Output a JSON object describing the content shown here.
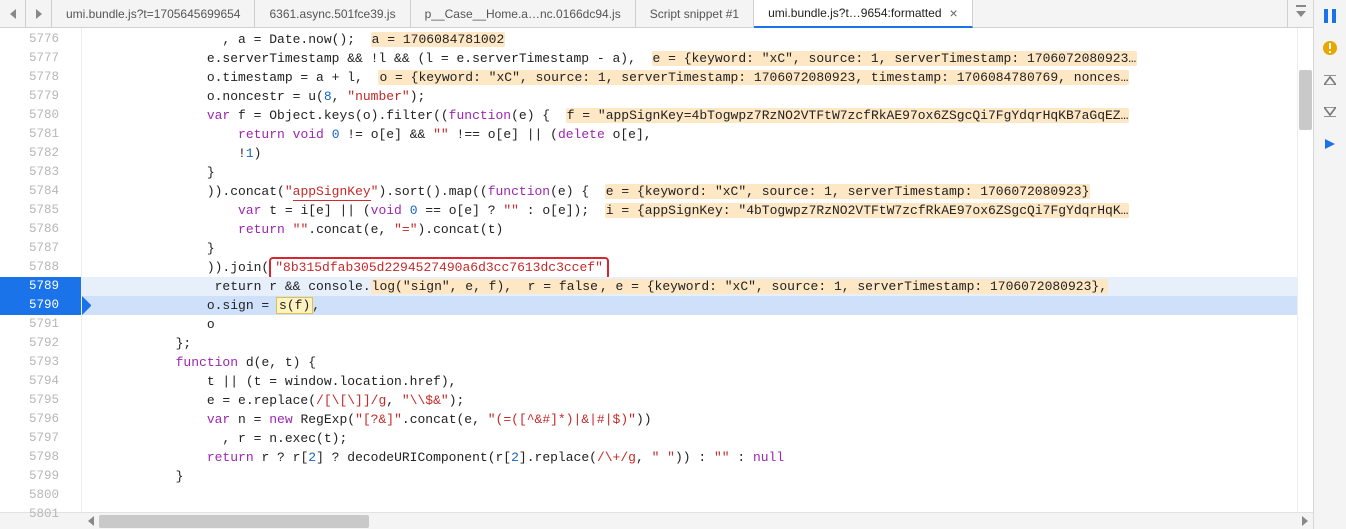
{
  "tabs": [
    {
      "label": "umi.bundle.js?t=1705645699654"
    },
    {
      "label": "6361.async.501fce39.js"
    },
    {
      "label": "p__Case__Home.a…nc.0166dc94.js"
    },
    {
      "label": "Script snippet #1"
    },
    {
      "label": "umi.bundle.js?t…9654:formatted",
      "active": true,
      "closable": true
    }
  ],
  "gutter": {
    "start": 5776,
    "end": 5801,
    "breakpoints": [
      5789,
      5790
    ],
    "paused": 5790
  },
  "side_rail": {
    "pause_color": "#1a73e8",
    "warn_color": "#e7a600"
  },
  "code": {
    "l5776": {
      "pre": "                  , a = Date.now();  ",
      "hl": "a = 1706084781002"
    },
    "l5777": {
      "pre": "                e.serverTimestamp && !l && (l = e.serverTimestamp - a),  ",
      "hl": "e = {keyword: \"xC\", source: 1, serverTimestamp: 1706072080923…"
    },
    "l5778": {
      "pre": "                o.timestamp = a + l,  ",
      "hl": "o = {keyword: \"xC\", source: 1, serverTimestamp: 1706072080923, timestamp: 1706084780769, nonces…"
    },
    "l5779": "                o.noncestr = u(8, \"number\");",
    "l5780": {
      "pre": "                var f = Object.keys(o).filter((function(e) {  ",
      "hl": "f = \"appSignKey=4bTogwpz7RzNO2VTFtW7zcfRkAE97ox6ZSgcQi7FgYdqrHqKB7aGqEZ…"
    },
    "l5781": "                    return void 0 != o[e] && \"\" !== o[e] || (delete o[e],",
    "l5782": "                    !1)",
    "l5783": "                }",
    "l5784": {
      "pre": "                )).concat(\"",
      "mid": "appSignKey",
      "post": "\").sort().map((function(e) {  ",
      "hl": "e = {keyword: \"xC\", source: 1, serverTimestamp: 1706072080923}"
    },
    "l5785": {
      "pre": "                    var t = i[e] || (void 0 == o[e] ? \"\" : o[e]);  ",
      "hl": "i = {appSignKey: \"4bTogwpz7RzNO2VTFtW7zcfRkAE97ox6ZSgcQi7FgYdqrHqK…"
    },
    "l5786": "                    return \"\".concat(e, \"=\").concat(t)",
    "l5787": "                }",
    "l5788": {
      "pre": "                )).join(",
      "box": "\"8b315dfab305d2294527490a6d3cc7613dc3ccef\""
    },
    "l5789": {
      "pre": "                 return r && console.",
      "mid": "log(\"sign\", e, f),  r = false",
      "post": ", e = {keyword: \"xC\", source: 1, serverTimestamp: 1706072080923},"
    },
    "l5790": {
      "pre": "                o.sign = ",
      "call": "s(f)",
      "post": ","
    },
    "l5791": "                o",
    "l5792": "            };",
    "l5793": "            function d(e, t) {",
    "l5794": "                t || (t = window.location.href),",
    "l5795": "                e = e.replace(/[\\[\\]]/g, \"\\\\$&\");",
    "l5796": "                var n = new RegExp(\"[?&]\".concat(e, \"(=([^&#]*)|&|#|$)\"))",
    "l5797": "                  , r = n.exec(t);",
    "l5798": "                return r ? r[2] ? decodeURIComponent(r[2].replace(/\\+/g, \" \")) : \"\" : null",
    "l5799": "            }",
    "l5800": "",
    "l5801": ""
  }
}
